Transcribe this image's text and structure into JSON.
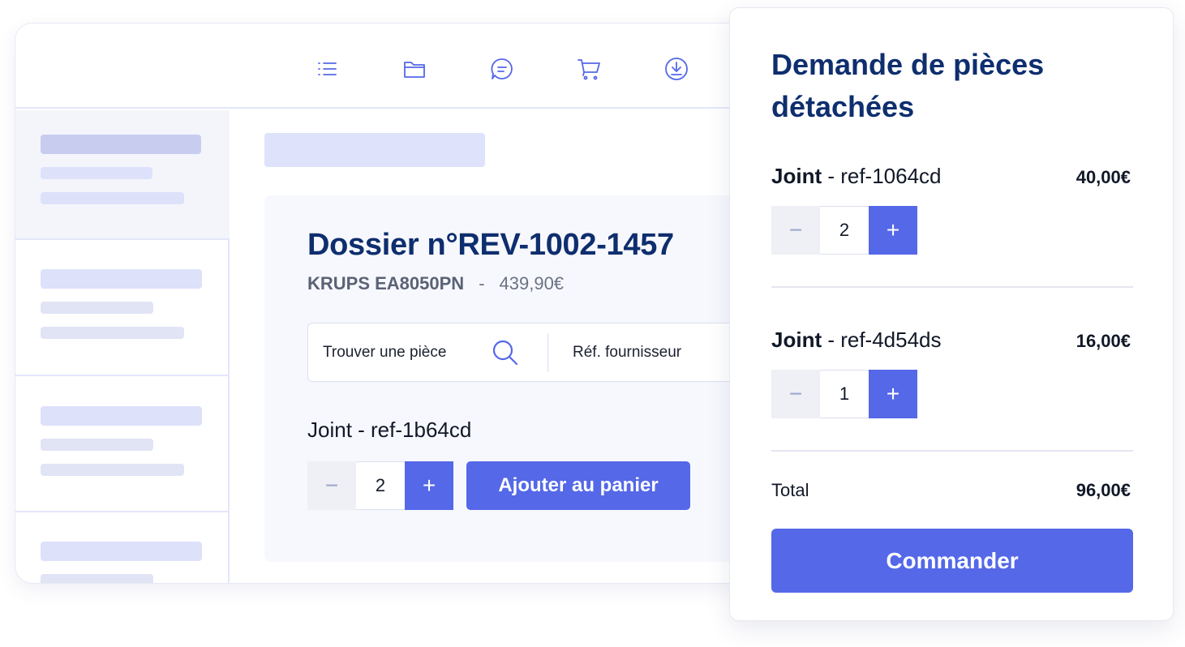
{
  "toolbar": {
    "icons": [
      "list-icon",
      "folder-icon",
      "chat-icon",
      "cart-icon",
      "download-icon"
    ]
  },
  "dossier": {
    "title": "Dossier n°REV-1002-1457",
    "model": "KRUPS EA8050PN",
    "separator": "-",
    "price": "439,90€",
    "search_label": "Trouver une pièce",
    "ref_label": "Réf. fournisseur",
    "item_label": "Joint - ref-1b64cd",
    "quantity": "2",
    "minus": "−",
    "plus": "+",
    "add_button": "Ajouter au panier"
  },
  "cart": {
    "title": "Demande de pièces détachées",
    "items": [
      {
        "name": "Joint",
        "ref": " - ref-1064cd",
        "price": "40,00€",
        "quantity": "2"
      },
      {
        "name": "Joint",
        "ref": " - ref-4d54ds",
        "price": "16,00€",
        "quantity": "1"
      }
    ],
    "total_label": "Total",
    "total_value": "96,00€",
    "order_button": "Commander"
  },
  "colors": {
    "accent": "#5468e8",
    "title": "#0e2e6e",
    "skeleton": "#dde1fa"
  }
}
